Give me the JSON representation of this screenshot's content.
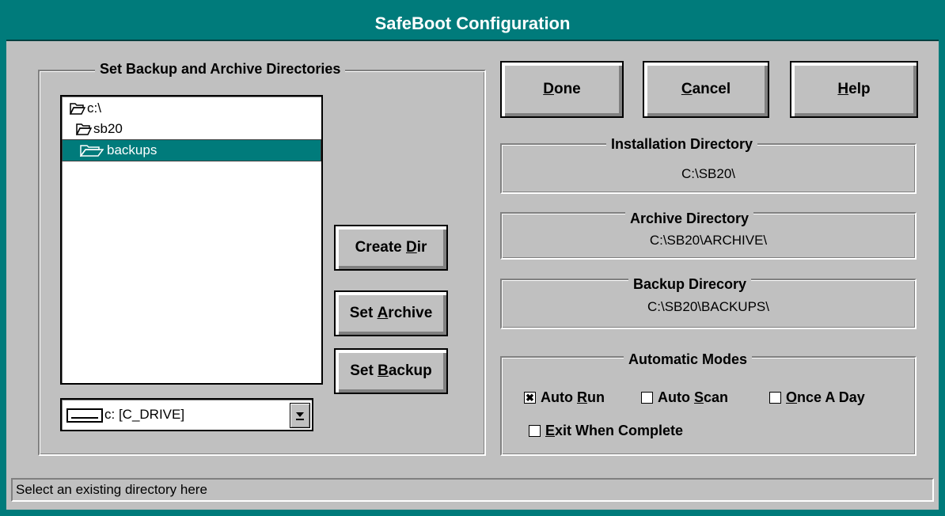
{
  "window": {
    "title": "SafeBoot Configuration"
  },
  "directories": {
    "group_title": "Set Backup and Archive Directories",
    "tree": [
      {
        "label": "c:\\",
        "selected": false
      },
      {
        "label": "sb20",
        "selected": false
      },
      {
        "label": "backups",
        "selected": true
      }
    ],
    "drive": {
      "value": "c: [C_DRIVE]",
      "icon": "drive-icon"
    }
  },
  "actions": {
    "create_dir": {
      "pre": "Create ",
      "key": "D",
      "post": "ir"
    },
    "set_archive": {
      "pre": "Set ",
      "key": "A",
      "post": "rchive"
    },
    "set_backup": {
      "pre": "Set ",
      "key": "B",
      "post": "ackup"
    }
  },
  "toolbar": {
    "done": {
      "key": "D",
      "post": "one"
    },
    "cancel": {
      "key": "C",
      "post": "ancel"
    },
    "help": {
      "key": "H",
      "post": "elp"
    }
  },
  "installation": {
    "title": "Installation Directory",
    "value": "C:\\SB20\\"
  },
  "archive": {
    "title": "Archive Directory",
    "value": "C:\\SB20\\ARCHIVE\\"
  },
  "backup": {
    "title": "Backup Direcory",
    "value": "C:\\SB20\\BACKUPS\\"
  },
  "modes": {
    "title": "Automatic Modes",
    "auto_run": {
      "pre": "Auto ",
      "key": "R",
      "post": "un",
      "checked": true,
      "mark": "✖"
    },
    "auto_scan": {
      "pre": "Auto ",
      "key": "S",
      "post": "can",
      "checked": false
    },
    "once_a_day": {
      "pre": "",
      "key": "O",
      "post": "nce A Day",
      "checked": false
    },
    "exit_when_complete": {
      "pre": "",
      "key": "E",
      "post": "xit When Complete",
      "checked": false
    }
  },
  "status_bar": {
    "text": "Select an existing directory here"
  },
  "colors": {
    "title_bar": "#007b7b",
    "face": "#c0c0c0",
    "selection": "#007b7b"
  }
}
